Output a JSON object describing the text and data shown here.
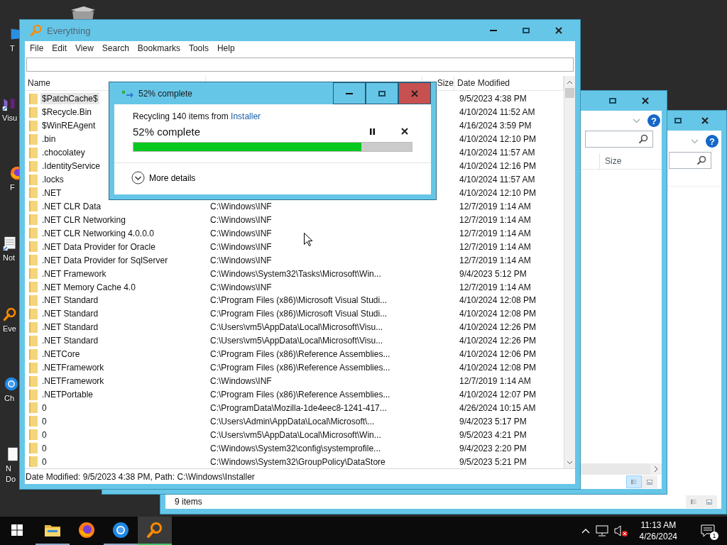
{
  "desktop_icons": [
    {
      "kind": "pc",
      "label": "T"
    },
    {
      "kind": "studio",
      "label": "Visu"
    },
    {
      "kind": "fox",
      "label": "F"
    },
    {
      "kind": "note",
      "label": "Not"
    },
    {
      "kind": "search",
      "label": "Eve"
    },
    {
      "kind": "globe",
      "label": "Ch"
    },
    {
      "kind": "doc",
      "label": "N Do"
    }
  ],
  "explorer_back": {
    "help": "?",
    "status": "9 items",
    "views": [
      {
        "kind": "details",
        "selected": false
      },
      {
        "kind": "preview",
        "selected": false
      }
    ]
  },
  "explorer_front": {
    "help": "?",
    "columns": [
      "Size"
    ],
    "views": [
      {
        "kind": "details",
        "selected": true
      },
      {
        "kind": "preview",
        "selected": false
      }
    ]
  },
  "everything": {
    "title": "Everything",
    "menu": [
      "File",
      "Edit",
      "View",
      "Search",
      "Bookmarks",
      "Tools",
      "Help"
    ],
    "columns": {
      "name": "Name",
      "size": "Size",
      "date": "Date Modified"
    },
    "rows": [
      {
        "name": "$PatchCache$",
        "date": "9/5/2023 4:38 PM",
        "selected": true
      },
      {
        "name": "$Recycle.Bin",
        "date": "4/10/2024 11:52 AM",
        "selected": false
      },
      {
        "name": "$WinREAgent",
        "date": "4/16/2024 3:59 PM",
        "selected": false
      },
      {
        "name": ".bin",
        "date": "4/10/2024 12:10 PM",
        "selected": false
      },
      {
        "name": ".chocolatey",
        "date": "4/10/2024 11:57 AM",
        "selected": false
      },
      {
        "name": ".IdentityService",
        "date": "4/10/2024 12:16 PM",
        "selected": false
      },
      {
        "name": ".locks",
        "date": "4/10/2024 11:57 AM",
        "selected": false
      },
      {
        "name": ".NET",
        "date": "4/10/2024 12:10 PM",
        "selected": false
      },
      {
        "name": ".NET CLR Data",
        "path": "C:\\Windows\\INF",
        "date": "12/7/2019 1:14 AM",
        "selected": false
      },
      {
        "name": ".NET CLR Networking",
        "path": "C:\\Windows\\INF",
        "date": "12/7/2019 1:14 AM",
        "selected": false
      },
      {
        "name": ".NET CLR Networking 4.0.0.0",
        "path": "C:\\Windows\\INF",
        "date": "12/7/2019 1:14 AM",
        "selected": false
      },
      {
        "name": ".NET Data Provider for Oracle",
        "path": "C:\\Windows\\INF",
        "date": "12/7/2019 1:14 AM",
        "selected": false
      },
      {
        "name": ".NET Data Provider for SqlServer",
        "path": "C:\\Windows\\INF",
        "date": "12/7/2019 1:14 AM",
        "selected": false
      },
      {
        "name": ".NET Framework",
        "path": "C:\\Windows\\System32\\Tasks\\Microsoft\\Win...",
        "date": "9/4/2023 5:12 PM",
        "selected": false
      },
      {
        "name": ".NET Memory Cache 4.0",
        "path": "C:\\Windows\\INF",
        "date": "12/7/2019 1:14 AM",
        "selected": false
      },
      {
        "name": ".NET Standard",
        "path": "C:\\Program Files (x86)\\Microsoft Visual Studi...",
        "date": "4/10/2024 12:08 PM",
        "selected": false
      },
      {
        "name": ".NET Standard",
        "path": "C:\\Program Files (x86)\\Microsoft Visual Studi...",
        "date": "4/10/2024 12:08 PM",
        "selected": false
      },
      {
        "name": ".NET Standard",
        "path": "C:\\Users\\vm5\\AppData\\Local\\Microsoft\\Visu...",
        "date": "4/10/2024 12:26 PM",
        "selected": false
      },
      {
        "name": ".NET Standard",
        "path": "C:\\Users\\vm5\\AppData\\Local\\Microsoft\\Visu...",
        "date": "4/10/2024 12:26 PM",
        "selected": false
      },
      {
        "name": ".NETCore",
        "path": "C:\\Program Files (x86)\\Reference Assemblies...",
        "date": "4/10/2024 12:06 PM",
        "selected": false
      },
      {
        "name": ".NETFramework",
        "path": "C:\\Program Files (x86)\\Reference Assemblies...",
        "date": "4/10/2024 12:08 PM",
        "selected": false
      },
      {
        "name": ".NETFramework",
        "path": "C:\\Windows\\INF",
        "date": "12/7/2019 1:14 AM",
        "selected": false
      },
      {
        "name": ".NETPortable",
        "path": "C:\\Program Files (x86)\\Reference Assemblies...",
        "date": "4/10/2024 12:07 PM",
        "selected": false
      },
      {
        "name": "0",
        "path": "C:\\ProgramData\\Mozilla-1de4eec8-1241-417...",
        "date": "4/26/2024 10:15 AM",
        "selected": false
      },
      {
        "name": "0",
        "path": "C:\\Users\\Admin\\AppData\\Local\\Microsoft\\...",
        "date": "9/4/2023 5:17 PM",
        "selected": false
      },
      {
        "name": "0",
        "path": "C:\\Users\\vm5\\AppData\\Local\\Microsoft\\Win...",
        "date": "9/5/2023 4:21 PM",
        "selected": false
      },
      {
        "name": "0",
        "path": "C:\\Windows\\System32\\config\\systemprofile...",
        "date": "9/4/2023 2:20 PM",
        "selected": false
      },
      {
        "name": "0",
        "path": "C:\\Windows\\System32\\GroupPolicy\\DataStore",
        "date": "9/5/2023 5:21 PM",
        "selected": false
      }
    ],
    "status": "Date Modified: 9/5/2023 4:38 PM, Path: C:\\Windows\\Installer"
  },
  "dialog": {
    "title": "52% complete",
    "message": "Recycling 140 items from",
    "source": "Installer",
    "progress_text": "52% complete",
    "level": 0.82,
    "details": "More details"
  },
  "taskbar": {
    "apps": [
      {
        "kind": "folder",
        "running": true,
        "selected": false
      },
      {
        "kind": "fox",
        "running": false,
        "selected": false
      },
      {
        "kind": "globe",
        "running": true,
        "selected": false
      },
      {
        "kind": "search",
        "running": true,
        "selected": true
      }
    ],
    "time": "11:13 AM",
    "date": "4/26/2024",
    "notifications": "1"
  }
}
